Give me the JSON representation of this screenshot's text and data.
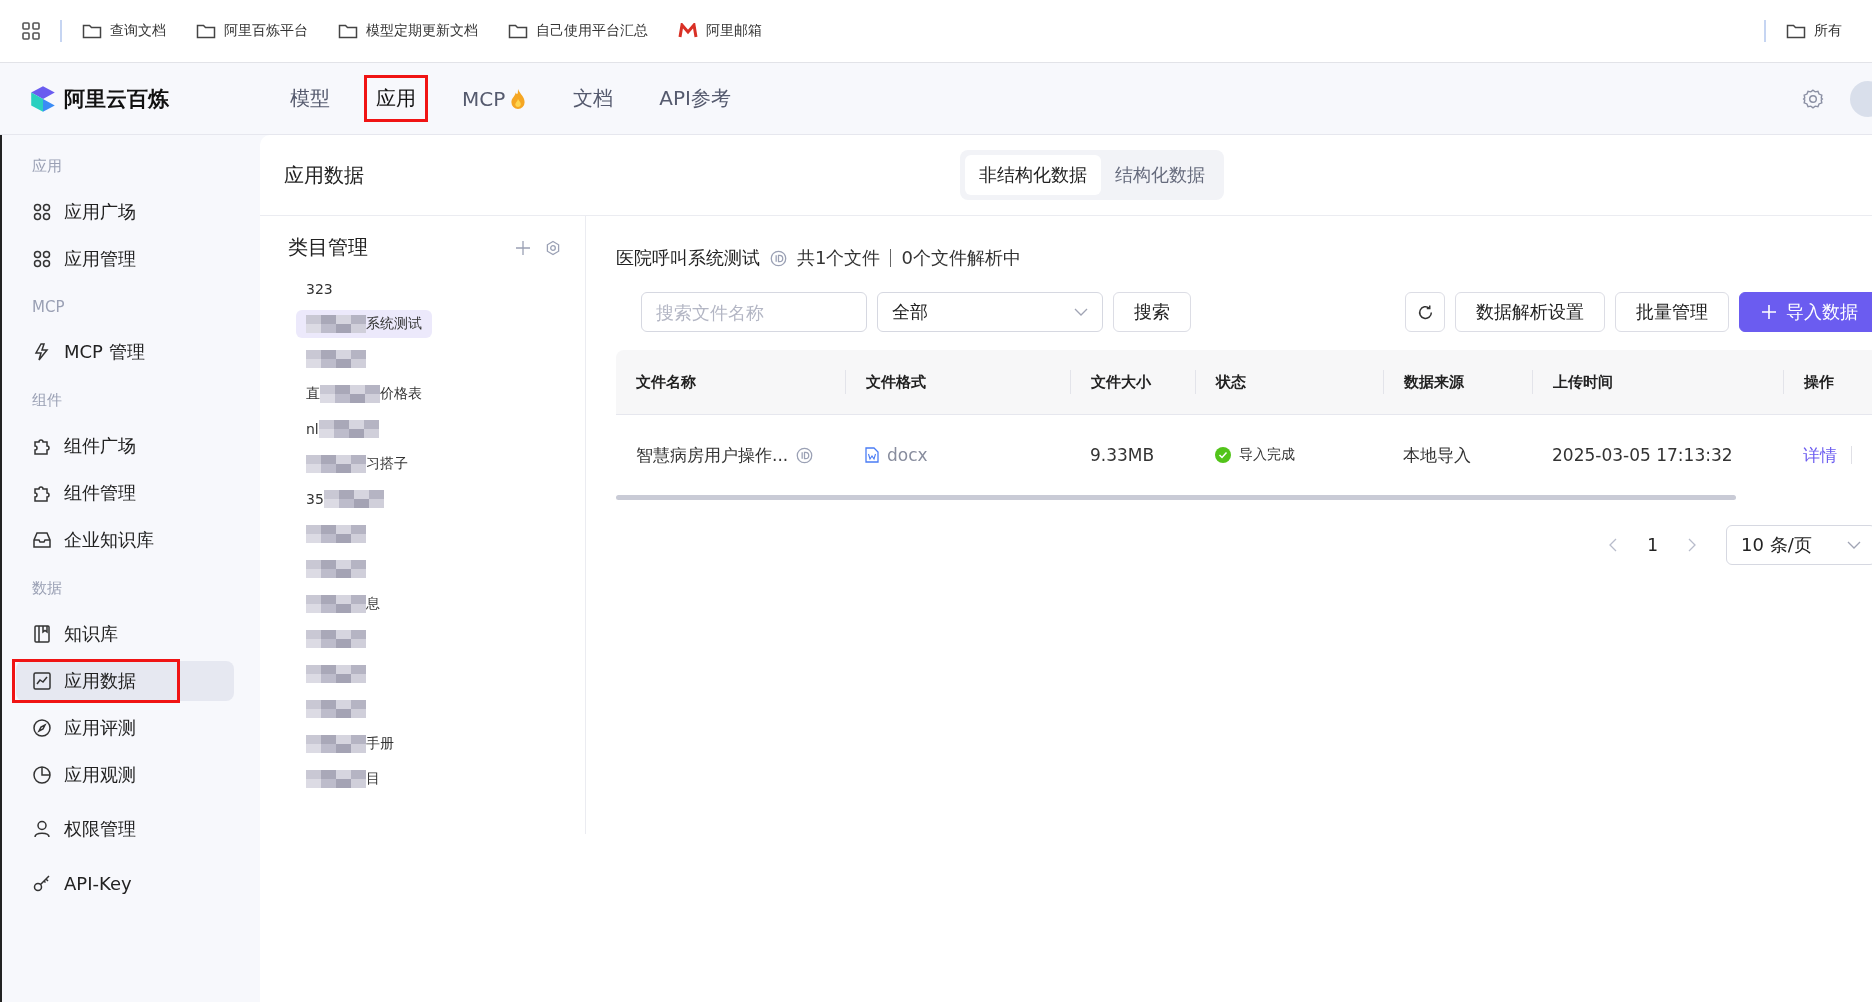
{
  "bookmarks": {
    "items": [
      {
        "kind": "folder",
        "label": "查询文档"
      },
      {
        "kind": "folder",
        "label": "阿里百炼平台"
      },
      {
        "kind": "folder",
        "label": "模型定期更新文档"
      },
      {
        "kind": "folder",
        "label": "自己使用平台汇总"
      },
      {
        "kind": "mail",
        "label": "阿里邮箱"
      }
    ],
    "right": {
      "kind": "folder",
      "label": "所有"
    }
  },
  "brand": "阿里云百炼",
  "nav_tabs": [
    {
      "label": "模型",
      "selected": false,
      "annotated": false,
      "hot": false
    },
    {
      "label": "应用",
      "selected": true,
      "annotated": true,
      "hot": false
    },
    {
      "label": "MCP",
      "selected": false,
      "annotated": false,
      "hot": true
    },
    {
      "label": "文档",
      "selected": false,
      "annotated": false,
      "hot": false
    },
    {
      "label": "API参考",
      "selected": false,
      "annotated": false,
      "hot": false
    }
  ],
  "sidebar": {
    "sections": [
      {
        "title": "应用",
        "items": [
          {
            "label": "应用广场",
            "selected": false,
            "annotated": false
          },
          {
            "label": "应用管理",
            "selected": false,
            "annotated": false
          }
        ]
      },
      {
        "title": "MCP",
        "items": [
          {
            "label": "MCP 管理",
            "selected": false,
            "annotated": false
          }
        ]
      },
      {
        "title": "组件",
        "items": [
          {
            "label": "组件广场",
            "selected": false,
            "annotated": false
          },
          {
            "label": "组件管理",
            "selected": false,
            "annotated": false
          },
          {
            "label": "企业知识库",
            "selected": false,
            "annotated": false
          }
        ]
      },
      {
        "title": "数据",
        "items": [
          {
            "label": "知识库",
            "selected": false,
            "annotated": false
          },
          {
            "label": "应用数据",
            "selected": true,
            "annotated": true
          },
          {
            "label": "应用评测",
            "selected": false,
            "annotated": false
          },
          {
            "label": "应用观测",
            "selected": false,
            "annotated": false
          }
        ]
      },
      {
        "items": [
          {
            "label": "权限管理",
            "selected": false,
            "annotated": false
          },
          {
            "label": "API-Key",
            "selected": false,
            "annotated": false
          }
        ]
      }
    ]
  },
  "page": {
    "title": "应用数据",
    "data_tabs": [
      {
        "label": "非结构化数据",
        "selected": true
      },
      {
        "label": "结构化数据",
        "selected": false
      }
    ]
  },
  "categories": {
    "title": "类目管理",
    "items": [
      {
        "before": "323",
        "redacted": false,
        "selected": false
      },
      {
        "after": "系统测试",
        "redacted": true,
        "selected": true
      },
      {
        "redacted": true,
        "selected": false
      },
      {
        "before": "直",
        "after": "价格表",
        "redacted": true,
        "selected": false
      },
      {
        "before": "nl",
        "redacted": true,
        "selected": false
      },
      {
        "after": "习搭子",
        "redacted": true,
        "selected": false
      },
      {
        "before": "35",
        "redacted": true,
        "selected": false
      },
      {
        "redacted": true,
        "selected": false
      },
      {
        "redacted": true,
        "selected": false
      },
      {
        "after": "息",
        "redacted": true,
        "selected": false
      },
      {
        "redacted": true,
        "selected": false
      },
      {
        "redacted": true,
        "selected": false
      },
      {
        "redacted": true,
        "selected": false
      },
      {
        "after": "手册",
        "redacted": true,
        "selected": false
      },
      {
        "after": "目",
        "redacted": true,
        "selected": false
      }
    ]
  },
  "files": {
    "category": "医院呼叫系统测试",
    "summary": "共1个文件",
    "parsing": "0个文件解析中",
    "search": {
      "placeholder": "搜索文件名称"
    },
    "filter": "全部",
    "search_button": "搜索",
    "buttons": [
      {
        "kind": "refresh"
      },
      {
        "kind": "default",
        "label": "数据解析设置"
      },
      {
        "kind": "default",
        "label": "批量管理"
      },
      {
        "kind": "primary",
        "label": "导入数据"
      }
    ],
    "columns": [
      "文件名称",
      "文件格式",
      "文件大小",
      "状态",
      "数据来源",
      "上传时间",
      "操作"
    ],
    "rows": [
      {
        "name": "智慧病房用户操作...",
        "format": "docx",
        "size": "9.33MB",
        "status": "导入完成",
        "source": "本地导入",
        "uploaded": "2025-03-05 17:13:32",
        "action": "详情"
      }
    ],
    "pagination": {
      "page": "1",
      "page_size": "10 条/页"
    }
  }
}
